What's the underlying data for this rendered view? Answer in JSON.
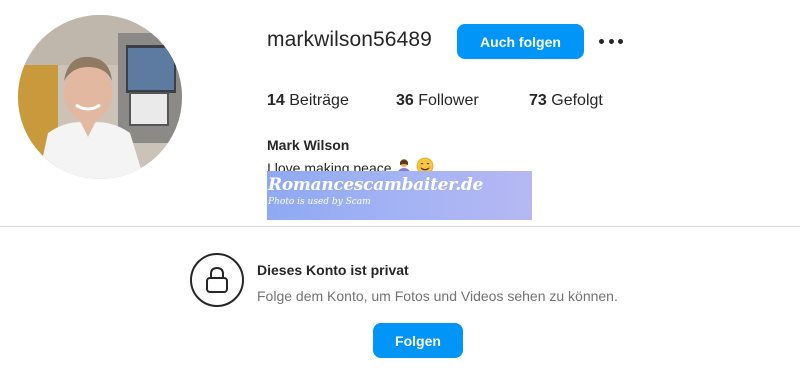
{
  "profile": {
    "username": "markwilson56489",
    "follow_button_top": "Auch folgen",
    "more_options_icon": "more-horizontal-icon",
    "full_name": "Mark Wilson",
    "bio_text": "I love making peace",
    "bio_emojis": [
      "person-bowing-emoji",
      "smiling-face-emoji"
    ]
  },
  "stats": {
    "posts_count": "14",
    "posts_label": "Beiträge",
    "followers_count": "36",
    "followers_label": "Follower",
    "following_count": "73",
    "following_label": "Gefolgt"
  },
  "watermark": {
    "site": "Romancescambaiter.de",
    "note": "Photo is used by Scam"
  },
  "private_notice": {
    "icon": "lock-icon",
    "title": "Dieses Konto ist privat",
    "subtitle": "Folge dem Konto, um Fotos und Videos sehen zu können.",
    "follow_button": "Folgen"
  },
  "colors": {
    "primary_button": "#0095f6",
    "text_primary": "#262626",
    "text_secondary": "#737373",
    "divider": "#dbdbdb"
  }
}
